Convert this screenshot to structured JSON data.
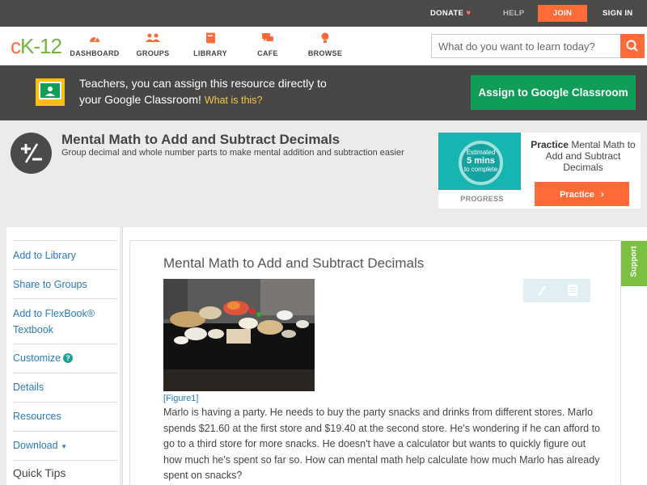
{
  "topbar": {
    "donate": "DONATE",
    "help": "HELP",
    "join": "JOIN",
    "signin": "SIGN IN",
    "heart_color": "#ff6c6c"
  },
  "brand": {
    "logo_prefix": "c",
    "logo_rest": "K-12",
    "accent": "#ff6b38",
    "green": "#75b43f"
  },
  "nav": {
    "items": [
      {
        "label": "DASHBOARD",
        "icon": "dashboard-icon"
      },
      {
        "label": "GROUPS",
        "icon": "groups-icon"
      },
      {
        "label": "LIBRARY",
        "icon": "library-icon"
      },
      {
        "label": "CAFE",
        "icon": "cafe-icon"
      },
      {
        "label": "BROWSE",
        "icon": "browse-icon"
      }
    ]
  },
  "search": {
    "placeholder": "What do you want to learn today?"
  },
  "classroom": {
    "line1": "Teachers, you can assign this resource directly to",
    "line2": "your Google Classroom!",
    "what_link": "What is this?",
    "button": "Assign to Google Classroom"
  },
  "header": {
    "title": "Mental Math to Add and Subtract Decimals",
    "subtitle": "Group decimal and whole number parts to make mental addition and subtraction easier",
    "badge_symbol": "+/−"
  },
  "practice": {
    "estimated": "Estimated",
    "mins": "5 mins",
    "to_complete": "to complete",
    "progress_label": "PROGRESS",
    "bold": "Practice",
    "text": "Mental Math to Add and Subtract Decimals",
    "button": "Practice"
  },
  "sidebar": {
    "items": [
      "Add to Library",
      "Share to Groups",
      "Add to FlexBook®",
      "Textbook",
      "Customize",
      "Details",
      "Resources",
      "Download"
    ],
    "quick_tips": "Quick Tips"
  },
  "content": {
    "title": "Mental Math to Add and Subtract Decimals",
    "figure_caption": "[Figure1]",
    "paragraph": "Marlo is having a party. He needs to buy the party snacks and drinks from different stores. Marlo spends $21.60 at the first store and $19.40 at the second store. He's wondering if he can afford to go to a third store for more snacks. He doesn't have a calculator but wants to quickly figure out how much he's spent so far so. How can mental math help calculate how much Marlo has already spent on snacks?",
    "support": "Support"
  }
}
